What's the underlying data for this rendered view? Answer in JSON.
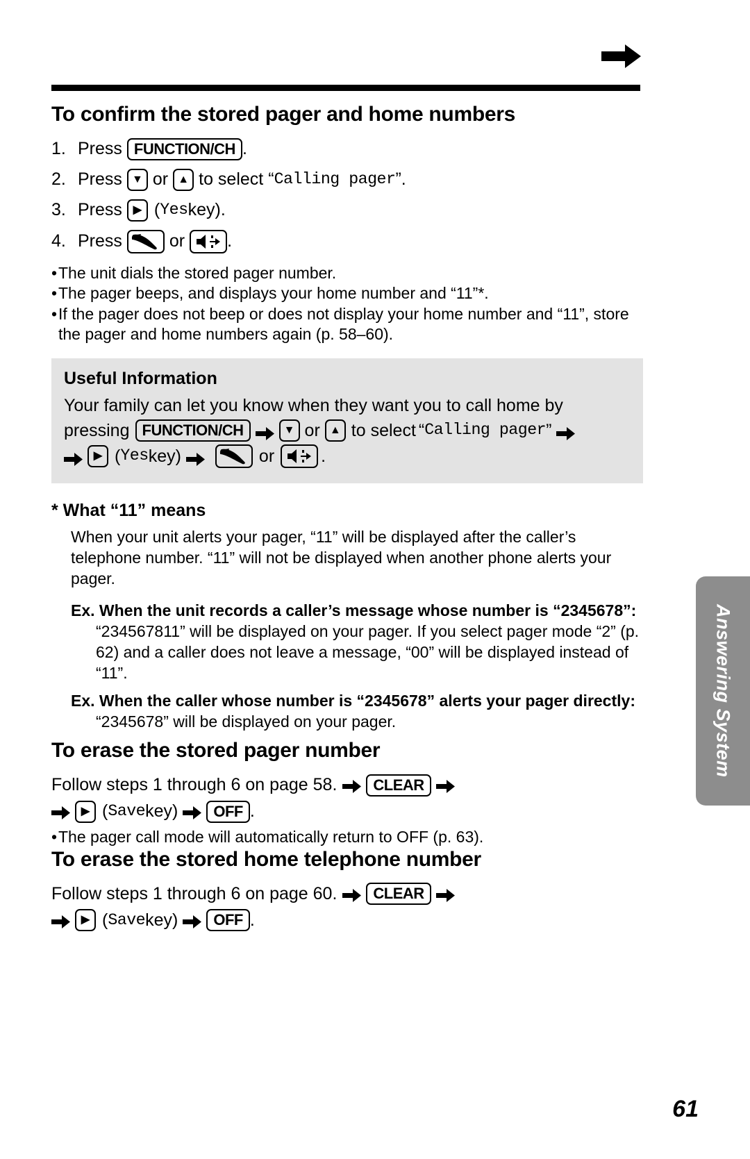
{
  "page": {
    "number": "61",
    "side_tab_label": "Answering System",
    "top_arrow_icon": "arrow-right-icon"
  },
  "section_confirm": {
    "title": "To confirm the stored pager and home numbers",
    "steps": [
      {
        "num": "1.",
        "pre": "Press",
        "key": "FUNCTION/CH",
        "post": "."
      },
      {
        "num": "2.",
        "pre": "Press",
        "key_down": "▼",
        "mid": "or",
        "key_up": "▲",
        "mid2": "to select",
        "quote_open": "“",
        "value": "Calling pager",
        "quote_close": "”",
        "post": "."
      },
      {
        "num": "3.",
        "pre": "Press",
        "key_right": "▶",
        "paren_open": "(",
        "value": "Yes",
        "label": " key)",
        "post": "."
      },
      {
        "num": "4.",
        "pre": "Press",
        "icon_handset": "handset-icon",
        "mid": "or",
        "icon_speaker": "speakerphone-icon",
        "post": "."
      }
    ],
    "bullets": [
      "The unit dials the stored pager number.",
      "The pager beeps, and displays your home number and “11”*.",
      "If the pager does not beep or does not display your home number and “11”, store the pager and home numbers again (p. 58–60)."
    ]
  },
  "useful_information": {
    "title": "Useful Information",
    "line1": "Your family can let you know when they want you to call home by",
    "line2_pre": "pressing",
    "line2_key": "FUNCTION/CH",
    "line2_down": "▼",
    "line2_or": "or",
    "line2_up": "▲",
    "line2_mid": "to select",
    "line2_quote_open": "“",
    "line2_value": "Calling pager",
    "line2_quote_close": "”",
    "line3_key_right": "▶",
    "line3_paren_open": "(",
    "line3_value": "Yes",
    "line3_label": " key)",
    "line3_or": "or",
    "line3_post": "."
  },
  "what_eleven": {
    "title": "* What “11” means",
    "body": "When your unit alerts your pager, “11” will be displayed after the caller’s telephone number. “11” will not be displayed when another phone alerts your pager.",
    "examples": [
      {
        "head": "Ex. When the unit records a caller’s message whose number is “2345678”:",
        "body": "“234567811” will be displayed on your pager. If you select pager mode “2” (p. 62) and a caller does not leave a message, “00” will be displayed instead of “11”."
      },
      {
        "head": "Ex. When the caller whose number is “2345678” alerts your pager directly:",
        "body": "“2345678” will be displayed on your pager."
      }
    ]
  },
  "section_erase_pager": {
    "title": "To erase the stored pager number",
    "line1_pre": "Follow steps 1 through 6 on page 58.",
    "line1_key": "CLEAR",
    "line2_key_right": "▶",
    "line2_paren_open": "(",
    "line2_value": "Save",
    "line2_label": " key)",
    "line2_key_off": "OFF",
    "line2_post": ".",
    "bullet": "The pager call mode will automatically return to OFF (p. 63)."
  },
  "section_erase_home": {
    "title": "To erase the stored home telephone number",
    "line1_pre": "Follow steps 1 through 6 on page 60.",
    "line1_key": "CLEAR",
    "line2_key_right": "▶",
    "line2_paren_open": "(",
    "line2_value": "Save",
    "line2_label": " key)",
    "line2_key_off": "OFF",
    "line2_post": "."
  }
}
